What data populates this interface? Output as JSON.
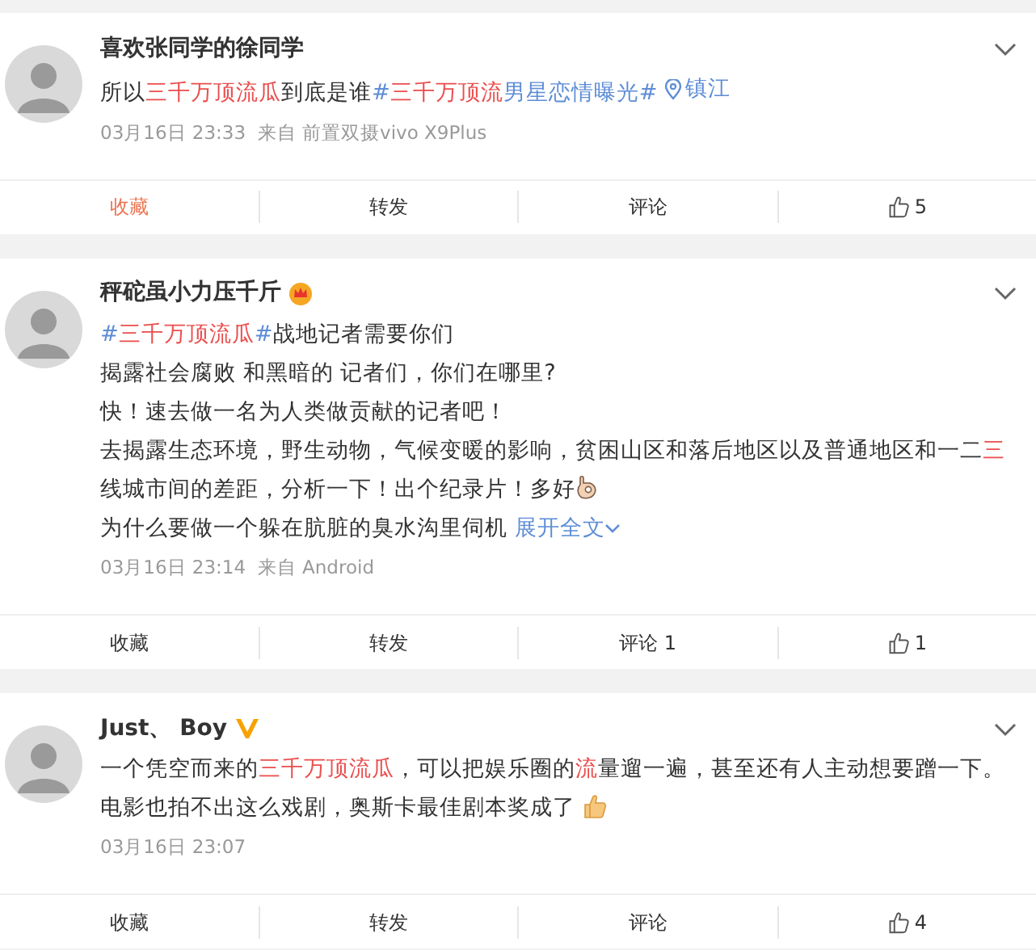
{
  "posts": [
    {
      "author": "喜欢张同学的徐同学",
      "paragraphs": [
        [
          {
            "kind": "text",
            "text": "所以"
          },
          {
            "kind": "keyword",
            "text": "三千万顶流瓜"
          },
          {
            "kind": "text",
            "text": "到底是谁"
          },
          {
            "kind": "topic",
            "text": "#"
          },
          {
            "kind": "keyword",
            "text": "三千万顶流"
          },
          {
            "kind": "topic",
            "text": "男星恋情曝光#"
          },
          {
            "kind": "location",
            "text": "镇江"
          }
        ]
      ],
      "meta": "03月16日 23:33  来自 前置双摄vivo X9Plus",
      "actions": [
        {
          "kind": "favorite",
          "label": "收藏",
          "selected": true
        },
        {
          "kind": "repost",
          "label": "转发"
        },
        {
          "kind": "comment",
          "label": "评论"
        },
        {
          "kind": "like",
          "count": "5"
        }
      ]
    },
    {
      "author": "秤砣虽小力压千斤",
      "crowned": true,
      "paragraphs": [
        [
          {
            "kind": "topic",
            "text": "#"
          },
          {
            "kind": "keyword",
            "text": "三千万顶流瓜"
          },
          {
            "kind": "topic",
            "text": "#"
          },
          {
            "kind": "text",
            "text": "战地记者需要你们"
          }
        ],
        [
          {
            "kind": "text",
            "text": "揭露社会腐败 和黑暗的 记者们，你们在哪里?"
          }
        ],
        [
          {
            "kind": "text",
            "text": "快！速去做一名为人类做贡献的记者吧！"
          }
        ],
        [
          {
            "kind": "text",
            "text": "去揭露生态环境，野生动物，气候变暖的影响，贫困山区和落后地区以及普通地区和一二"
          },
          {
            "kind": "keyword",
            "text": "三"
          },
          {
            "kind": "text",
            "text": "线城市间的差距，分析一下！出个纪录片！多好"
          },
          {
            "kind": "ok-hand"
          }
        ],
        [
          {
            "kind": "text",
            "text": "为什么要做一个躲在肮脏的臭水沟里伺机 "
          },
          {
            "kind": "more",
            "text": "展开全文"
          }
        ]
      ],
      "meta": "03月16日 23:14  来自 Android",
      "actions": [
        {
          "kind": "favorite",
          "label": "收藏",
          "selected": false
        },
        {
          "kind": "repost",
          "label": "转发"
        },
        {
          "kind": "comment",
          "label": "评论 1"
        },
        {
          "kind": "like",
          "count": "1"
        }
      ]
    },
    {
      "author": "Just、 Boy",
      "verified": true,
      "paragraphs": [
        [
          {
            "kind": "text",
            "text": "一个凭空而来的"
          },
          {
            "kind": "keyword",
            "text": "三千万顶流瓜"
          },
          {
            "kind": "text",
            "text": "，可以把娱乐圈的"
          },
          {
            "kind": "keyword",
            "text": "流"
          },
          {
            "kind": "text",
            "text": "量遛一遍，甚至还有人主动想要蹭一下。电影也拍不出这么戏剧，奥斯卡最佳剧本奖成了"
          },
          {
            "kind": "thumbs-up"
          }
        ]
      ],
      "meta": "03月16日 23:07",
      "actions": [
        {
          "kind": "favorite",
          "label": "收藏",
          "selected": false
        },
        {
          "kind": "repost",
          "label": "转发"
        },
        {
          "kind": "comment",
          "label": "评论"
        },
        {
          "kind": "like",
          "count": "4"
        }
      ]
    }
  ]
}
